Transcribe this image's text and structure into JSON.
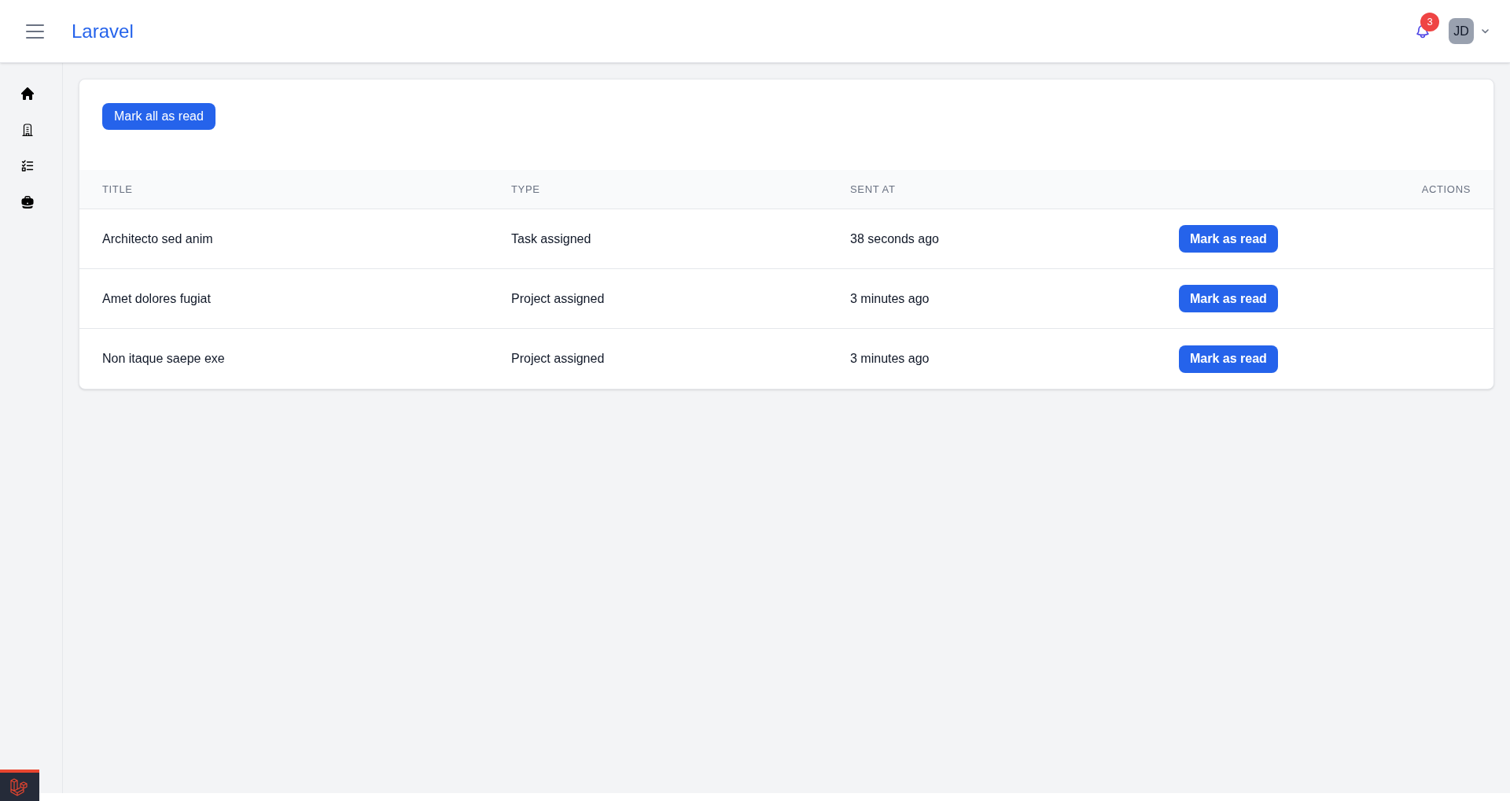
{
  "header": {
    "brand": "Laravel",
    "notification_count": "3",
    "user_initials": "JD"
  },
  "mark_all_button": "Mark all as read",
  "table": {
    "columns": [
      "TITLE",
      "TYPE",
      "SENT AT",
      "ACTIONS"
    ],
    "rows": [
      {
        "title": "Architecto sed anim",
        "type": "Task assigned",
        "sent_at": "38 seconds ago",
        "action": "Mark as read"
      },
      {
        "title": "Amet dolores fugiat",
        "type": "Project assigned",
        "sent_at": "3 minutes ago",
        "action": "Mark as read"
      },
      {
        "title": "Non itaque saepe exe",
        "type": "Project assigned",
        "sent_at": "3 minutes ago",
        "action": "Mark as read"
      }
    ]
  }
}
